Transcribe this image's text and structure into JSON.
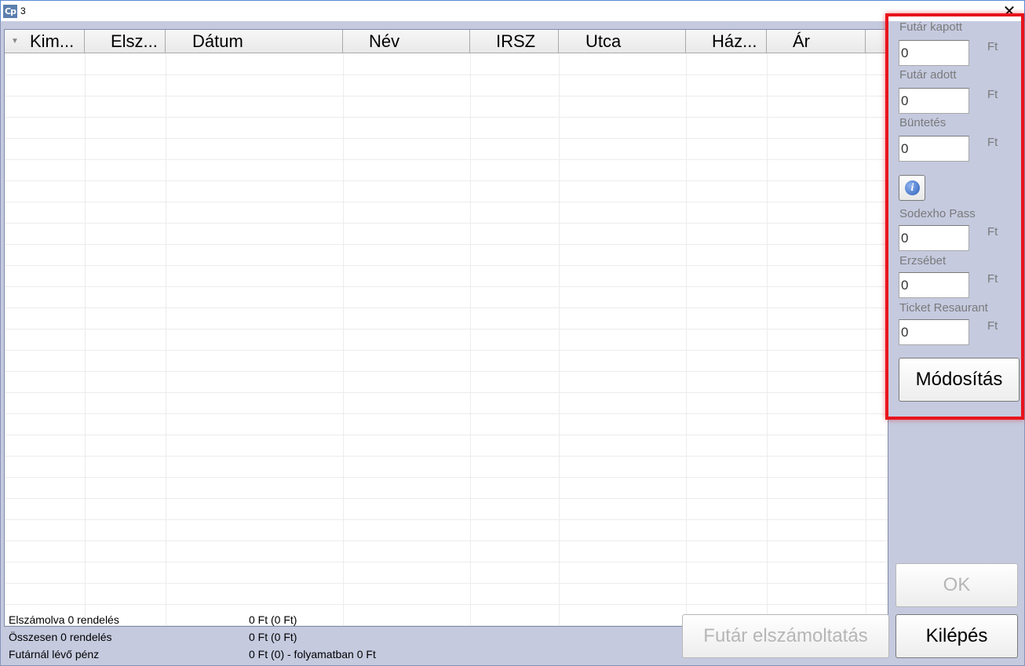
{
  "window": {
    "icon": "Cp",
    "title": "3",
    "close_glyph": "✕"
  },
  "grid": {
    "sort_icon": "▼",
    "columns": [
      "Kim...",
      "Elsz...",
      "Dátum",
      "Név",
      "IRSZ",
      "Utca",
      "Ház...",
      "Ár"
    ]
  },
  "panel": {
    "futar_kapott": {
      "label": "Futár kapott",
      "value": "0",
      "unit": "Ft"
    },
    "futar_adott": {
      "label": "Futár adott",
      "value": "0",
      "unit": "Ft"
    },
    "buntetes": {
      "label": "Büntetés",
      "value": "0",
      "unit": "Ft"
    },
    "info_icon": "i",
    "sodexho": {
      "label": "Sodexho Pass",
      "value": "0",
      "unit": "Ft"
    },
    "erzsebet": {
      "label": "Erzsébet",
      "value": "0",
      "unit": "Ft"
    },
    "ticket": {
      "label": "Ticket Resaurant",
      "value": "0",
      "unit": "Ft"
    },
    "modositas_label": "Módosítás"
  },
  "buttons": {
    "ok_label": "OK",
    "futar_elszamoltatas_label": "Futár elszámoltatás",
    "kilepes_label": "Kilépés"
  },
  "status": {
    "elszamolva_label": "Elszámolva 0 rendelés",
    "elszamolva_value": "0 Ft (0 Ft)",
    "osszesen_label": "Összesen 0 rendelés",
    "osszesen_value": "0 Ft (0 Ft)",
    "futarnal_label": "Futárnál lévő pénz",
    "futarnal_value": "0 Ft (0) - folyamatban 0 Ft"
  },
  "colors": {
    "highlight": "#e8141c",
    "window_bg": "#c5cadf"
  }
}
